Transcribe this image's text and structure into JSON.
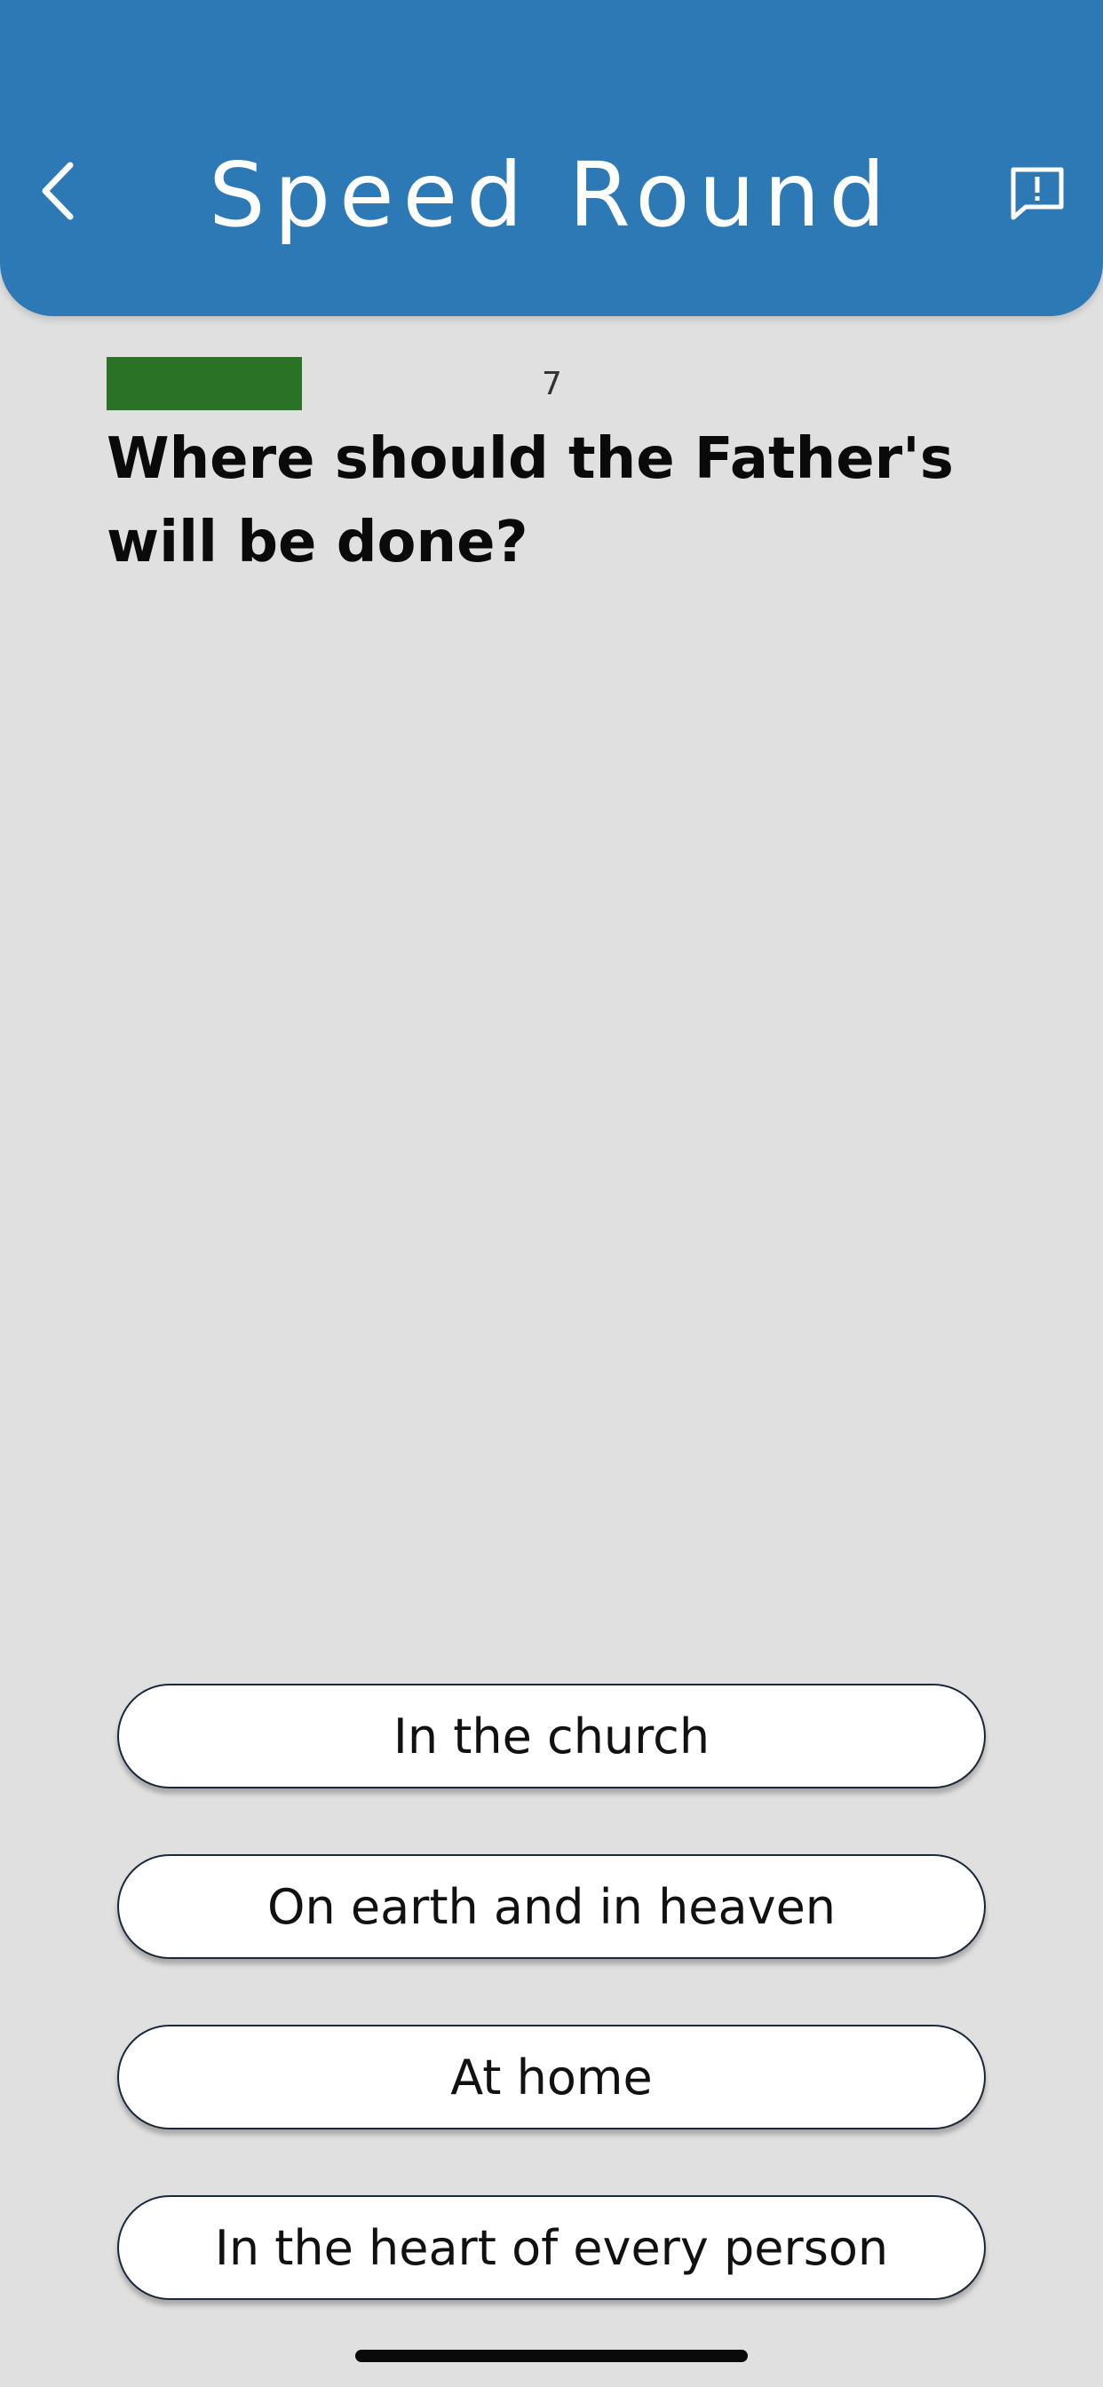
{
  "header": {
    "title": "Speed Round",
    "back_icon": "chevron-left-icon",
    "report_icon": "feedback-alert-icon",
    "background_color": "#2c79b5"
  },
  "timer": {
    "count": "7",
    "progress_fraction": 0.47,
    "bar_color": "#2a7326"
  },
  "question": {
    "text": "Where should the Father's will be done?"
  },
  "answers": [
    {
      "label": "In the church"
    },
    {
      "label": "On earth and in heaven"
    },
    {
      "label": "At home"
    },
    {
      "label": "In the heart of every person"
    }
  ]
}
